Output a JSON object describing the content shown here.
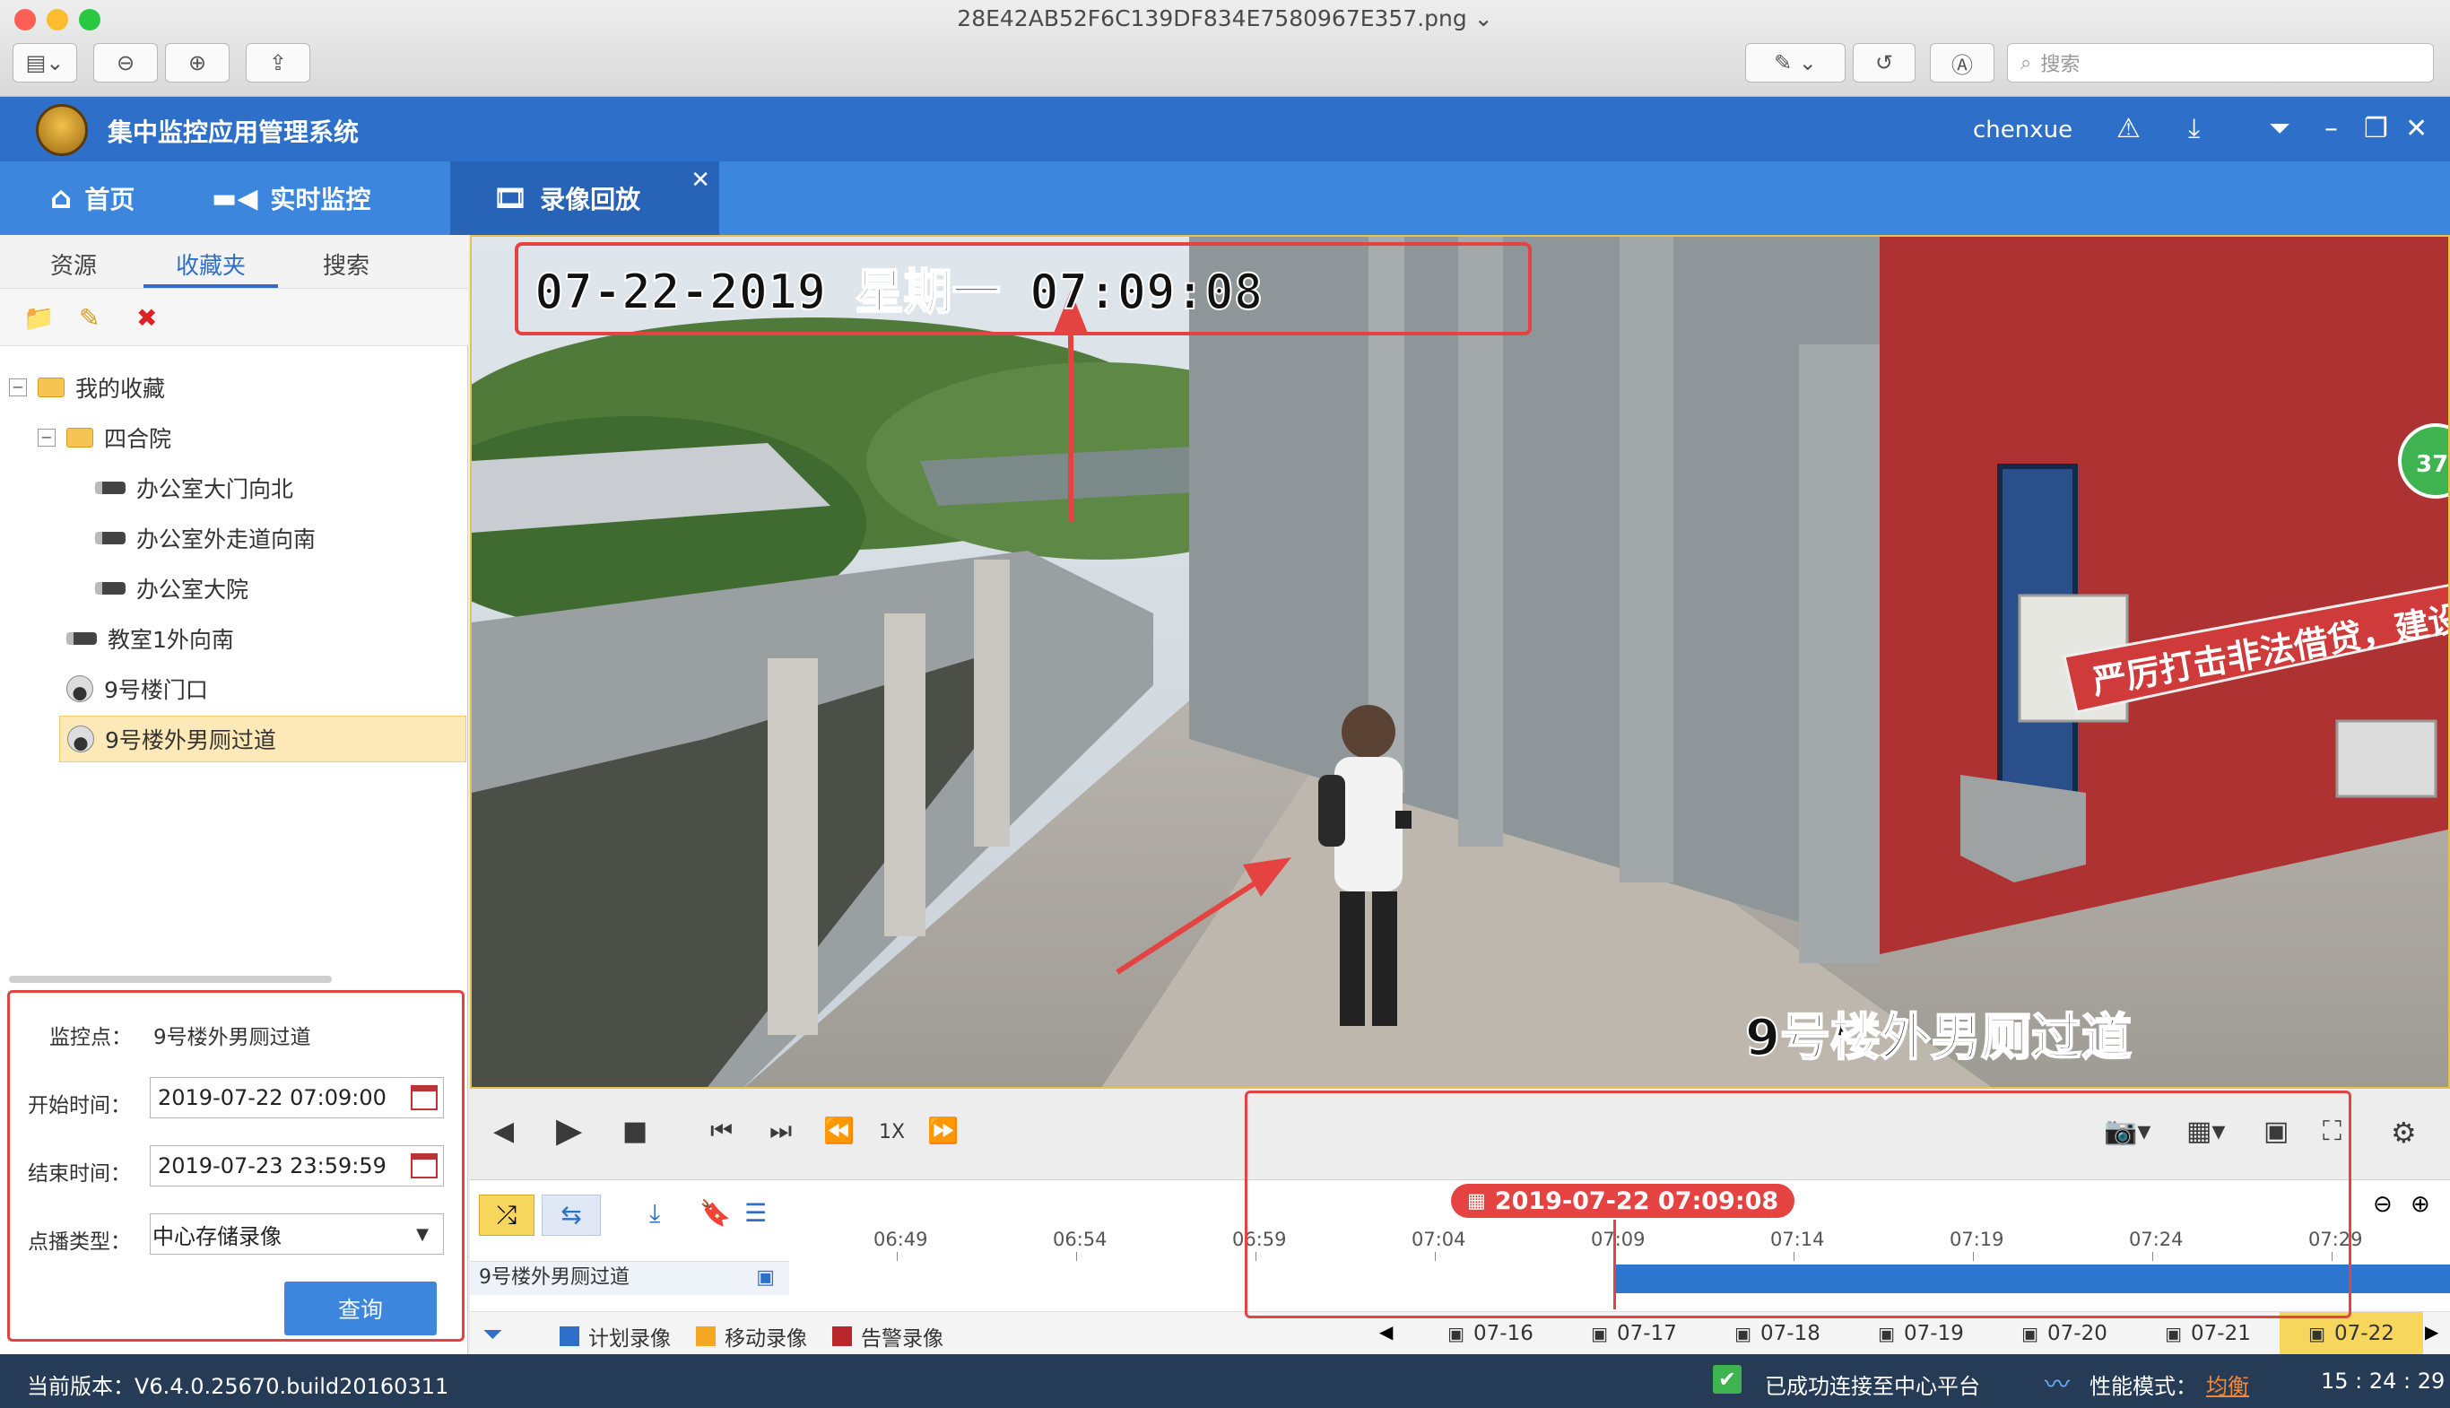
{
  "mac_window": {
    "filename": "28E42AB52F6C139DF834E7580967E357.png",
    "search_placeholder": "搜索"
  },
  "app": {
    "title": "集中监控应用管理系统",
    "user": "chenxue"
  },
  "tabs": [
    {
      "label": "首页"
    },
    {
      "label": "实时监控"
    },
    {
      "label": "录像回放"
    }
  ],
  "sidebar": {
    "subtabs": [
      "资源",
      "收藏夹",
      "搜索"
    ],
    "tree": [
      {
        "label": "我的收藏"
      },
      {
        "label": "四合院"
      },
      {
        "label": "办公室大门向北"
      },
      {
        "label": "办公室外走道向南"
      },
      {
        "label": "办公室大院"
      },
      {
        "label": "教室1外向南"
      },
      {
        "label": "9号楼门口"
      },
      {
        "label": "9号楼外男厕过道"
      }
    ]
  },
  "query": {
    "point_label": "监控点：",
    "point_value": "9号楼外男厕过道",
    "start_label": "开始时间：",
    "start_value": "2019-07-22 07:09:00",
    "end_label": "结束时间：",
    "end_value": "2019-07-23 23:59:59",
    "type_label": "点播类型：",
    "type_value": "中心存储录像",
    "button": "查询"
  },
  "video": {
    "osd_timestamp": "07-22-2019  星期一  07:09:08",
    "osd_camera": "9号楼外男厕过道",
    "banner_text": "严厉打击非法借贷，建设和谐平安",
    "badge": "37"
  },
  "controls": {
    "speed": "1X"
  },
  "timeline": {
    "current": "2019-07-22 07:09:08",
    "ticks": [
      "06:49",
      "06:54",
      "06:59",
      "07:04",
      "07:09",
      "07:14",
      "07:19",
      "07:24",
      "07:29"
    ],
    "track_name": "9号楼外男厕过道",
    "recording_start_tick": "07:09"
  },
  "legend": {
    "items": [
      {
        "label": "计划录像",
        "color": "#2d6fc9"
      },
      {
        "label": "移动录像",
        "color": "#f5a623"
      },
      {
        "label": "告警录像",
        "color": "#b9262b"
      }
    ],
    "dates": [
      "07-16",
      "07-17",
      "07-18",
      "07-19",
      "07-20",
      "07-21",
      "07-22"
    ],
    "active_date": "07-22"
  },
  "status": {
    "version": "当前版本：V6.4.0.25670.build20160311",
    "connection": "已成功连接至中心平台",
    "perf_label": "性能模式：",
    "perf_value": "均衡",
    "clock": "15 : 24 : 29"
  }
}
